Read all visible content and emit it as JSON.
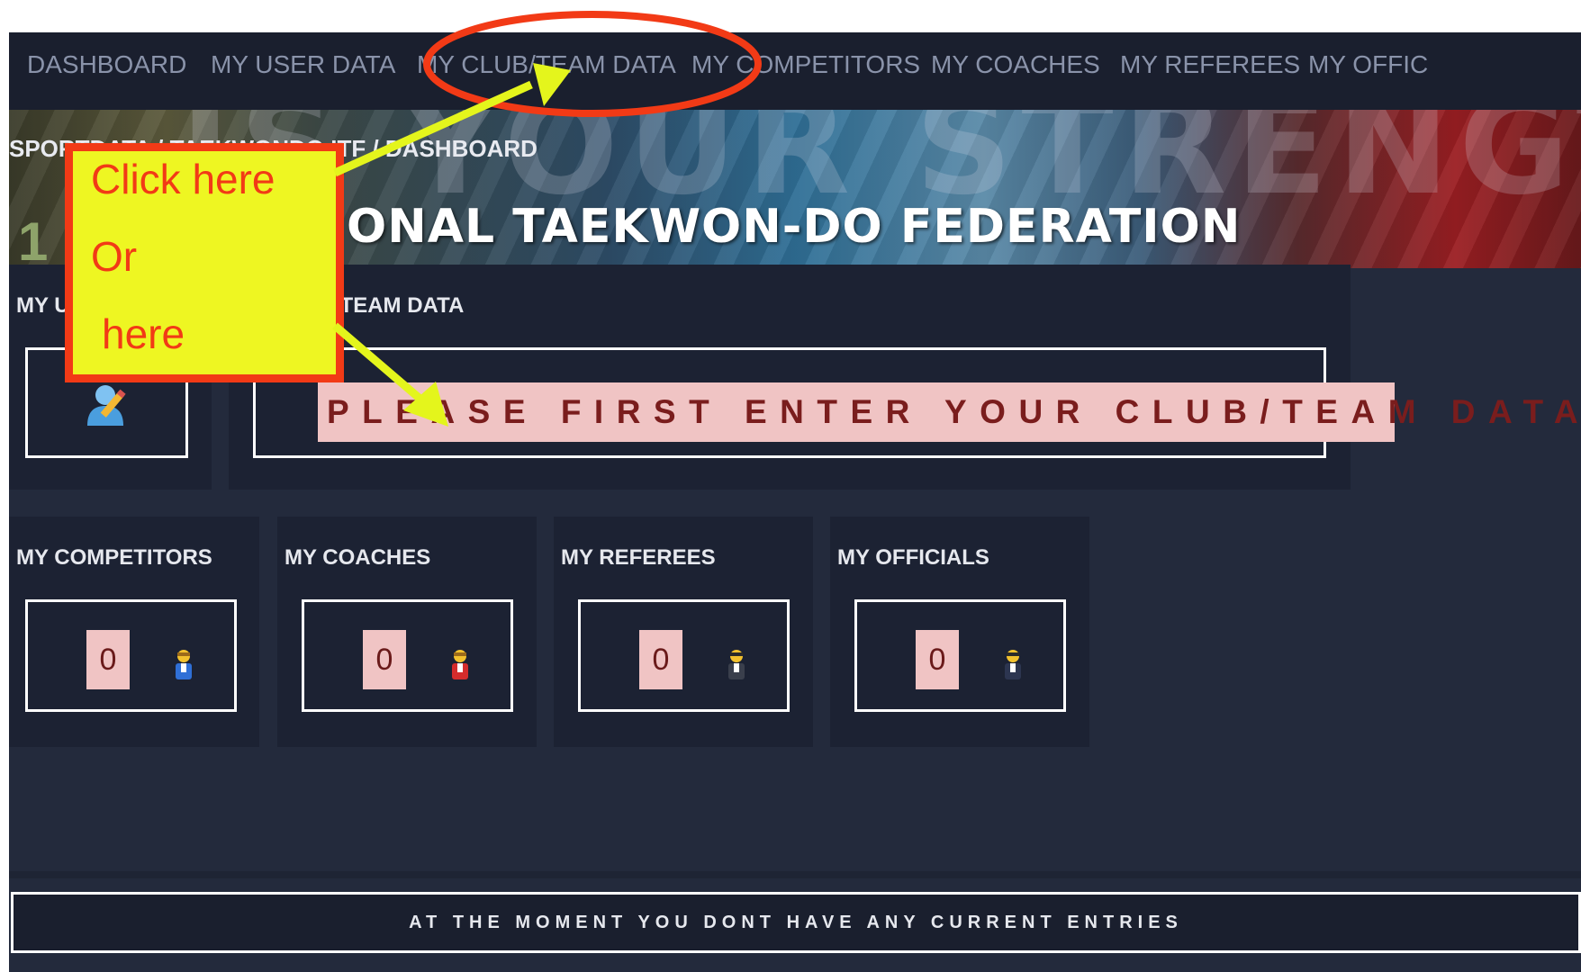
{
  "nav": {
    "items": [
      {
        "label": "DASHBOARD"
      },
      {
        "label": "MY USER DATA"
      },
      {
        "label": "MY CLUB/TEAM DATA"
      },
      {
        "label": "MY COMPETITORS"
      },
      {
        "label": "MY COACHES"
      },
      {
        "label": "MY REFEREES"
      },
      {
        "label": "MY OFFIC"
      }
    ]
  },
  "banner": {
    "breadcrumb": "SPORTDATA / TAEKWONDO ITF / DASHBOARD",
    "title": "ONAL TAEKWON-DO FEDERATION",
    "bg_word": "IS YOUR STRENGTH",
    "left_digit": "1"
  },
  "user_panel": {
    "title": "MY USER DATA",
    "icon": "user-edit-icon"
  },
  "club_panel": {
    "title": "MY CLUB/TEAM DATA",
    "notice": "PLEASE FIRST ENTER YOUR CLUB/TEAM DATA!"
  },
  "stats": [
    {
      "title": "MY COMPETITORS",
      "count": "0",
      "icon": "competitor-icon"
    },
    {
      "title": "MY COACHES",
      "count": "0",
      "icon": "coach-icon"
    },
    {
      "title": "MY REFEREES",
      "count": "0",
      "icon": "referee-icon"
    },
    {
      "title": "MY OFFICIALS",
      "count": "0",
      "icon": "official-icon"
    }
  ],
  "entries": {
    "text": "AT THE MOMENT YOU DONT HAVE ANY CURRENT ENTRIES"
  },
  "annotation": {
    "line1": "Click here",
    "line2": "Or",
    "line3": "here"
  },
  "colors": {
    "nav_bg": "#1a1f2e",
    "panel_bg": "#1c2233",
    "notice_bg": "#f0c4c4",
    "callout_bg": "#eef622",
    "callout_border": "#f23a16",
    "arrow": "#e4f51c"
  }
}
